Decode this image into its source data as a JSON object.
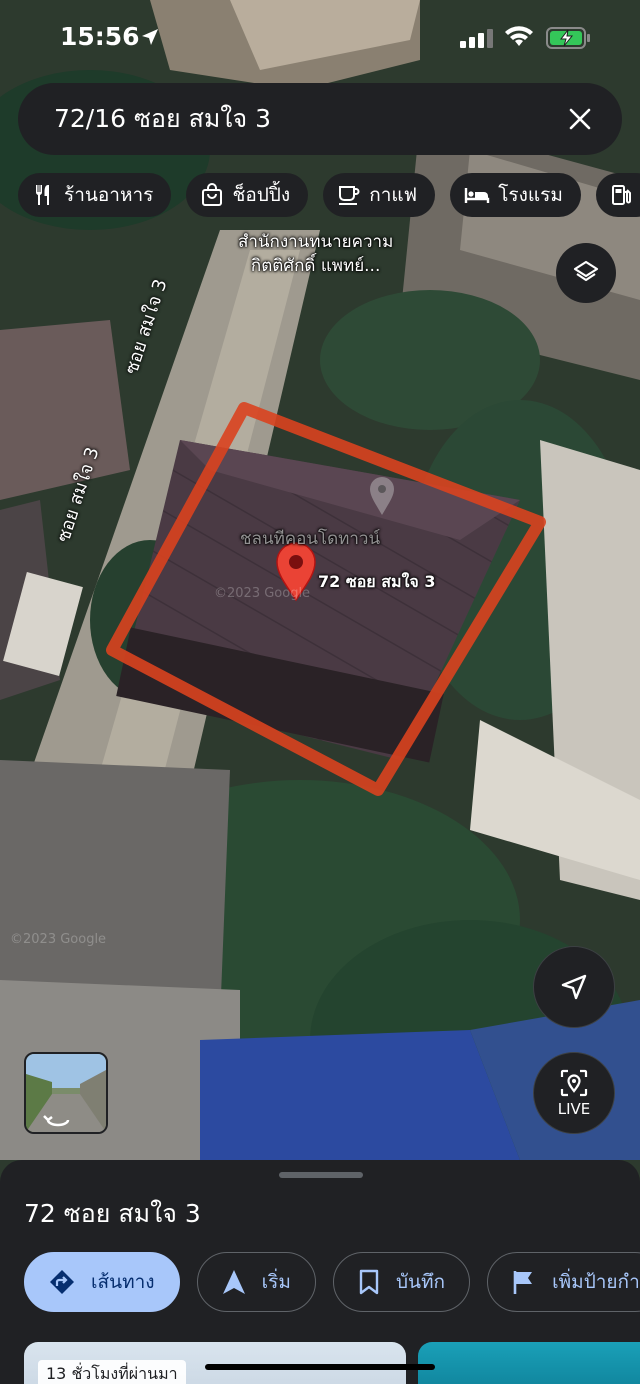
{
  "status_bar": {
    "time": "15:56",
    "icons": [
      "location-arrow-icon",
      "cellular-signal-icon",
      "wifi-icon",
      "battery-charging-icon"
    ]
  },
  "search": {
    "query": "72/16 ซอย สมใจ 3",
    "close_icon": "close-icon"
  },
  "chips": [
    {
      "label": "ร้านอาหาร",
      "icon": "restaurant-icon"
    },
    {
      "label": "ช็อปปิ้ง",
      "icon": "shopping-bag-icon"
    },
    {
      "label": "กาแฟ",
      "icon": "coffee-icon"
    },
    {
      "label": "โรงแรม",
      "icon": "hotel-icon"
    }
  ],
  "map": {
    "poi_line1": "สำนักงานทนายความ",
    "poi_line2": "กิตติศักดิ์ แพทย์...",
    "street_upper": "ซอย สมใจ 3",
    "street_lower": "ซอย สมใจ 3",
    "faint_place": "ชลนทีคอนโดทาวน์",
    "pin_label": "72 ซอย สมใจ 3",
    "watermark_1": "©2023 Google",
    "watermark_2": "©2023 Google",
    "boundary_color": "#d9421f",
    "pin_color": "#ea4335"
  },
  "buttons": {
    "layers_icon": "layers-icon",
    "navigate_icon": "navigation-arrow-icon",
    "live_label": "LIVE"
  },
  "sheet": {
    "title": "72 ซอย สมใจ 3",
    "actions": [
      {
        "label": "เส้นทาง",
        "icon": "directions-icon"
      },
      {
        "label": "เริ่ม",
        "icon": "start-navigation-icon"
      },
      {
        "label": "บันทึก",
        "icon": "bookmark-icon"
      },
      {
        "label": "เพิ่มป้ายกำ",
        "icon": "flag-icon"
      }
    ],
    "photo_badge": "13 ชั่วโมงที่ผ่านมา"
  }
}
